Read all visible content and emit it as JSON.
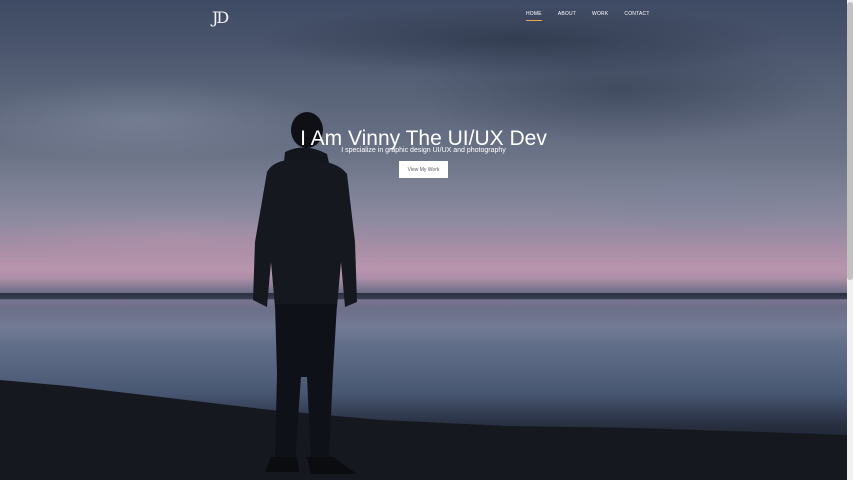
{
  "header": {
    "logo_text": "JD",
    "nav": [
      {
        "label": "HOME",
        "active": true
      },
      {
        "label": "ABOUT",
        "active": false
      },
      {
        "label": "WORK",
        "active": false
      },
      {
        "label": "CONTACT",
        "active": false
      }
    ]
  },
  "hero": {
    "title": "I Am Vinny The UI/UX Dev",
    "subtitle": "I specialize in graphic design UI/UX and photography",
    "cta_label": "View My Work"
  },
  "colors": {
    "accent": "#e8a54b",
    "text": "#ffffff",
    "button_bg": "#ffffff",
    "button_text": "#555a63"
  },
  "icons": {
    "logo": "jd-monogram"
  }
}
